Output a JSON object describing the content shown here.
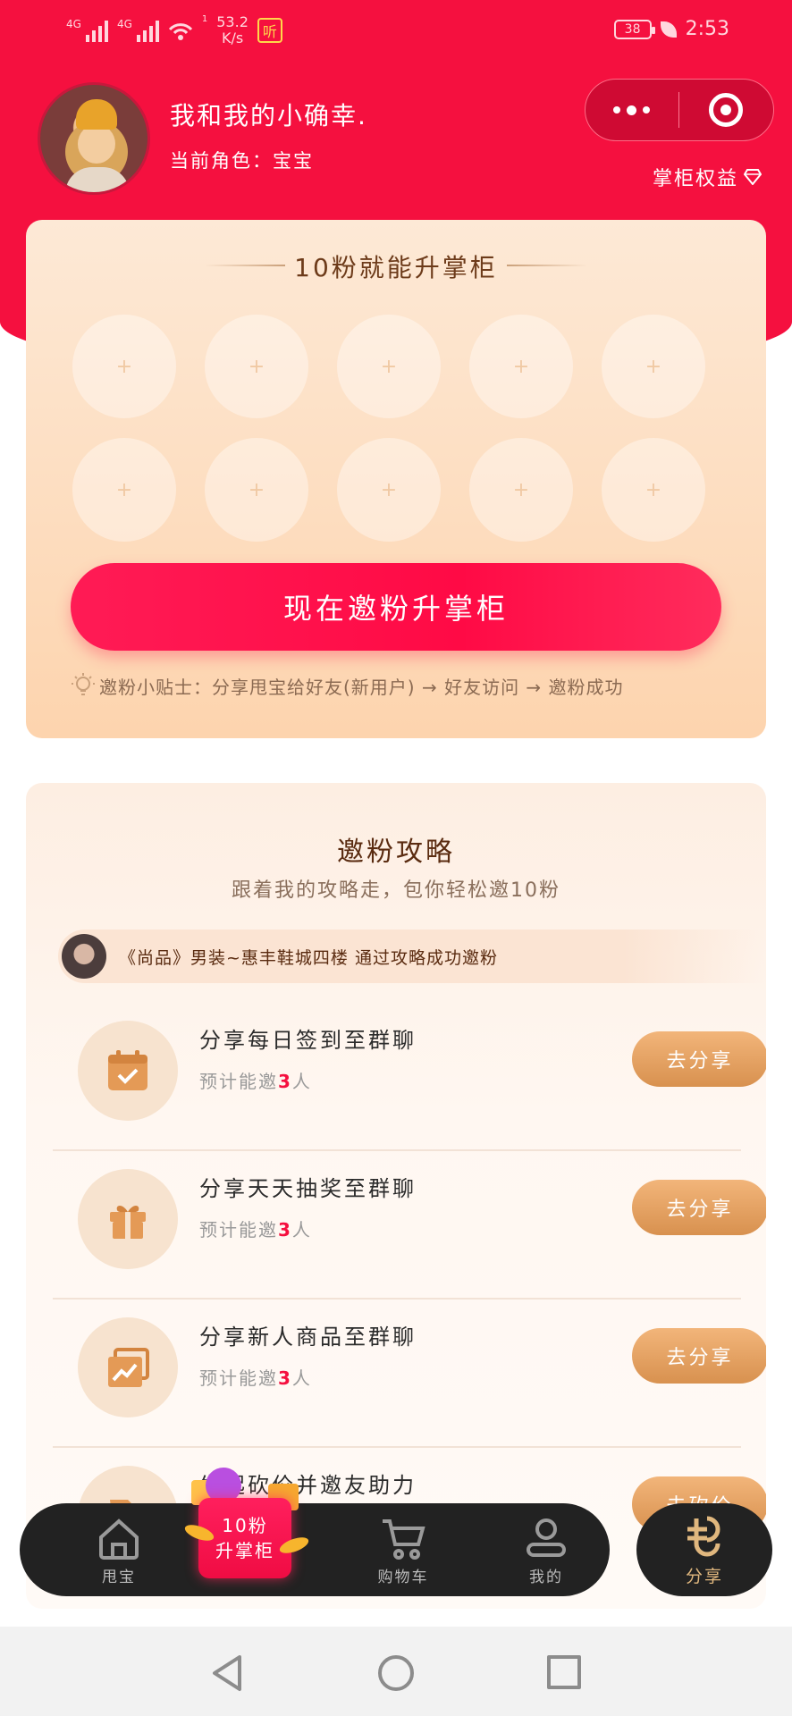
{
  "status_bar": {
    "signal1_label": "4G",
    "signal2_label": "4G",
    "net_speed_value": "53.2",
    "net_speed_unit": "K/s",
    "wifi_sup": "1",
    "listen_badge": "听",
    "battery": "38",
    "time": "2:53"
  },
  "profile": {
    "name": "我和我的小确幸.",
    "role": "当前角色：宝宝",
    "benefits_label": "掌柜权益"
  },
  "invite_card": {
    "title": "10粉就能升掌柜",
    "slots": [
      "+",
      "+",
      "+",
      "+",
      "+",
      "+",
      "+",
      "+",
      "+",
      "+"
    ],
    "button_label": "现在邀粉升掌柜",
    "tip": "邀粉小贴士：分享甩宝给好友(新用户) → 好友访问 → 邀粉成功"
  },
  "strategy": {
    "title": "邀粉攻略",
    "subtitle": "跟着我的攻略走，包你轻松邀10粉",
    "ticker_text": "《尚品》男装~惠丰鞋城四楼  通过攻略成功邀粉",
    "tasks": [
      {
        "title": "分享每日签到至群聊",
        "desc_prefix": "预计能邀",
        "count": "3",
        "desc_suffix": "人",
        "button": "去分享",
        "icon": "calendar-icon"
      },
      {
        "title": "分享天天抽奖至群聊",
        "desc_prefix": "预计能邀",
        "count": "3",
        "desc_suffix": "人",
        "button": "去分享",
        "icon": "gift-icon"
      },
      {
        "title": "分享新人商品至群聊",
        "desc_prefix": "预计能邀",
        "count": "3",
        "desc_suffix": "人",
        "button": "去分享",
        "icon": "product-chart-icon"
      },
      {
        "title": "发起砍价并邀友助力",
        "button": "去砍价",
        "icon": "tag-icon"
      }
    ]
  },
  "bottom_nav": {
    "home": "甩宝",
    "promo_line1": "10粉",
    "promo_line2": "升掌柜",
    "cart": "购物车",
    "mine": "我的",
    "share": "分享"
  },
  "colors": {
    "brand_red": "#f5103f",
    "gold": "#d8914f",
    "nav_dark": "#222222"
  }
}
